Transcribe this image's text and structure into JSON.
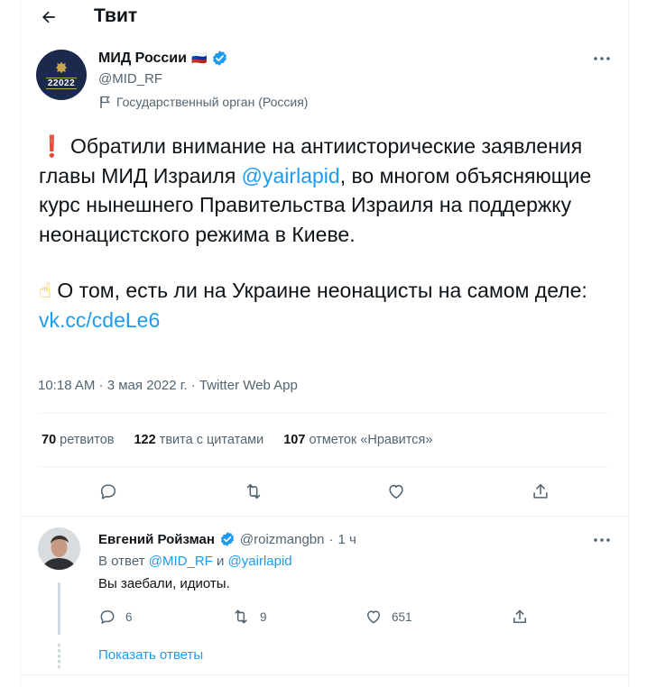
{
  "header": {
    "title": "Твит"
  },
  "tweet": {
    "author": {
      "name": "МИД России",
      "flag": "🇷🇺",
      "handle": "@MID_RF",
      "label": "Государственный орган (Россия)",
      "avatar_text": "22022"
    },
    "text": {
      "p1_emoji": "❗",
      "p1_a": " Обратили внимание на антиисторические заявления главы МИД Израиля ",
      "p1_mention": "@yairlapid",
      "p1_b": ", во многом объясняющие курс нынешнего Правительства Израиля на поддержку неонацистского режима в Киеве.",
      "p2_emoji": "☝",
      "p2_a": " О том, есть ли на Украине неонацисты на самом деле: ",
      "p2_link": "vk.cc/cdeLe6"
    },
    "meta": {
      "time": "10:18 AM",
      "sep": " · ",
      "date": "3 мая 2022 г.",
      "source": "Twitter Web App"
    },
    "stats": {
      "retweets_count": "70",
      "retweets_label": "ретвитов",
      "quotes_count": "122",
      "quotes_label": "твита с цитатами",
      "likes_count": "107",
      "likes_label": "отметок «Нравится»"
    }
  },
  "reply": {
    "name": "Евгений Ройзман",
    "handle": "@roizmangbn",
    "sep": "·",
    "time": "1 ч",
    "reply_prefix": "В ответ",
    "mention1": "@MID_RF",
    "conj": "и",
    "mention2": "@yairlapid",
    "text": "Вы заебали, идиоты.",
    "replies": "6",
    "retweets": "9",
    "likes": "651",
    "show_replies": "Показать ответы"
  },
  "colors": {
    "accent": "#1d9bf0",
    "secondary_text": "#536471",
    "divider": "#eff3f4",
    "verified": "#1d9bf0"
  }
}
